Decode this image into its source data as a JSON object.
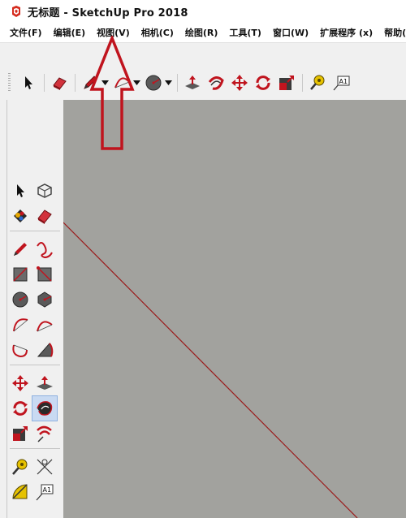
{
  "window": {
    "title": "无标题 - SketchUp Pro 2018"
  },
  "menu": {
    "items": [
      {
        "label": "文件(F)",
        "name": "menu-file"
      },
      {
        "label": "编辑(E)",
        "name": "menu-edit"
      },
      {
        "label": "视图(V)",
        "name": "menu-view"
      },
      {
        "label": "相机(C)",
        "name": "menu-camera"
      },
      {
        "label": "绘图(R)",
        "name": "menu-draw"
      },
      {
        "label": "工具(T)",
        "name": "menu-tools"
      },
      {
        "label": "窗口(W)",
        "name": "menu-window"
      },
      {
        "label": "扩展程序 (x)",
        "name": "menu-extensions"
      },
      {
        "label": "帮助(",
        "name": "menu-help"
      }
    ]
  },
  "toolbar": {
    "tools": [
      "select-tool",
      "eraser-tool",
      "pencil-tool",
      "arc-tool",
      "circle-tool",
      "push-pull-tool",
      "follow-me-tool",
      "move-tool",
      "rotate-tool",
      "scale-tool",
      "tape-measure-tool",
      "text-tool"
    ],
    "text_tool_label": "A1"
  },
  "left_toolbar": {
    "tools": [
      "select",
      "make-component",
      "paint-bucket",
      "eraser",
      "line",
      "freehand",
      "rectangle",
      "rotated-rectangle",
      "circle",
      "polygon",
      "arc",
      "arc-2point",
      "arc-3point",
      "pie",
      "move",
      "push-pull",
      "rotate",
      "follow-me",
      "scale",
      "offset",
      "tape-measure",
      "dimension",
      "protractor",
      "text"
    ],
    "active_tool": "follow-me",
    "text_label": "A1"
  },
  "annotation": {
    "arrow_color": "#c0141e",
    "points_to": "menu-view"
  },
  "colors": {
    "viewport_bg": "#a2a29e",
    "axis_red": "#9b1b1b",
    "tool_red": "#c0141e"
  }
}
